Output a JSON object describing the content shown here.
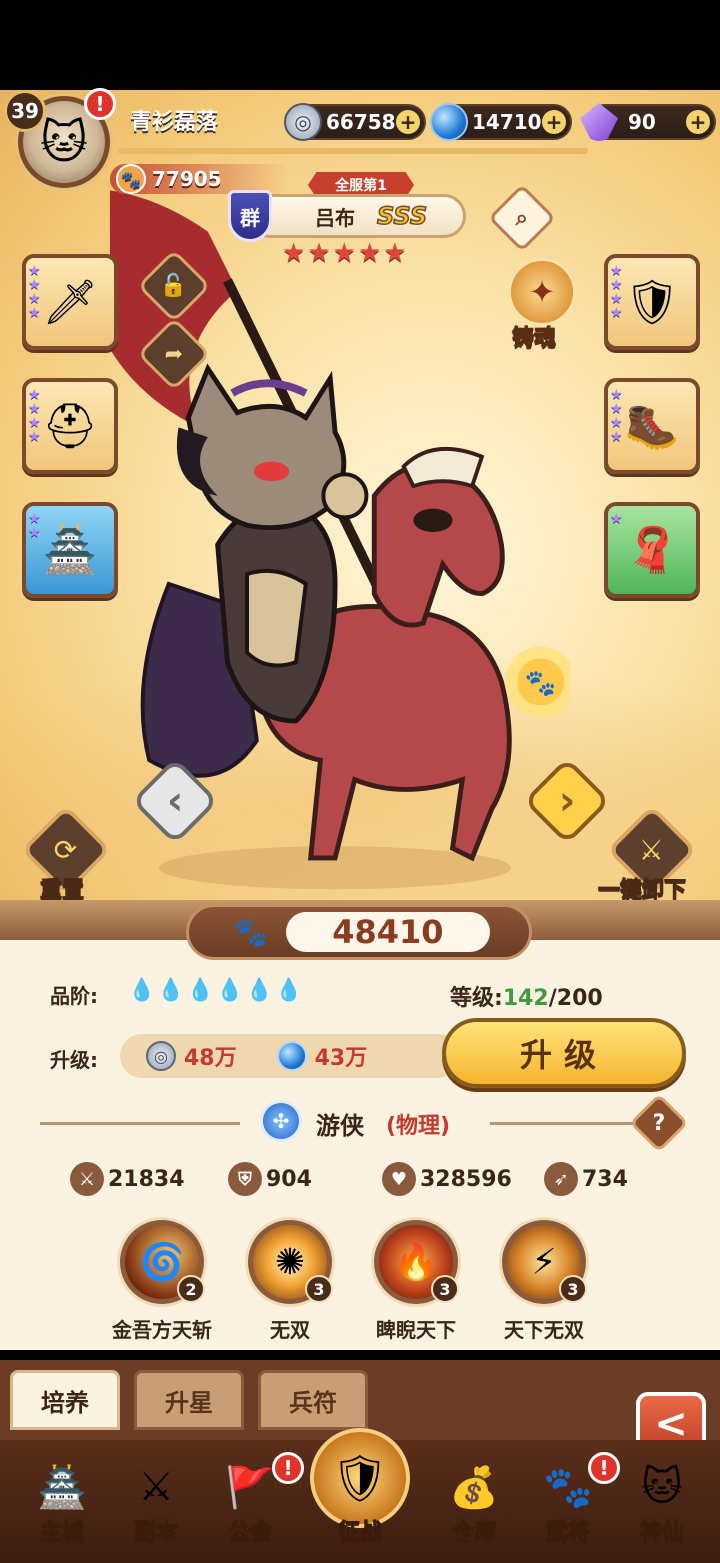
{
  "player": {
    "level": "39",
    "name": "青衫磊落",
    "power": "77905",
    "alert": "!"
  },
  "resources": [
    {
      "icon": "silver-coin-icon",
      "value": "66758"
    },
    {
      "icon": "blue-orb-icon",
      "value": "14710"
    },
    {
      "icon": "purple-crystal-icon",
      "value": "90"
    }
  ],
  "hero": {
    "rank_tag": "全服第1",
    "faction": "群",
    "name": "吕布",
    "grade": "SSS",
    "stars": 5,
    "combat_power": "48410",
    "quality_label": "品阶:",
    "quality_count": 6,
    "level_label": "等级:",
    "level_current": "142",
    "level_max": "/200",
    "upgrade_label": "升级:",
    "cost_silver": "48万",
    "cost_orb": "43万",
    "upgrade_button": "升级",
    "class_name": "游侠",
    "class_type": "(物理)",
    "help": "?"
  },
  "forge": {
    "label": "铸魂"
  },
  "actions": {
    "reset": "重置",
    "unequip_all": "一键卸下"
  },
  "stats": [
    {
      "icon": "attack-icon",
      "value": "21834"
    },
    {
      "icon": "defense-icon",
      "value": "904"
    },
    {
      "icon": "health-icon",
      "value": "328596"
    },
    {
      "icon": "speed-icon",
      "value": "734"
    }
  ],
  "skills": [
    {
      "name": "金吾方天斩",
      "level": "2"
    },
    {
      "name": "无双",
      "level": "3"
    },
    {
      "name": "睥睨天下",
      "level": "3"
    },
    {
      "name": "天下无双",
      "level": "3"
    }
  ],
  "tabs": [
    "培养",
    "升星",
    "兵符"
  ],
  "back": "<",
  "nav": [
    {
      "label": "主城",
      "icon": "city-icon"
    },
    {
      "label": "副本",
      "icon": "dungeon-icon"
    },
    {
      "label": "公会",
      "icon": "guild-icon"
    },
    {
      "label": "征战",
      "icon": "battle-icon"
    },
    {
      "label": "仓库",
      "icon": "warehouse-icon"
    },
    {
      "label": "武将",
      "icon": "generals-icon"
    },
    {
      "label": "神仙",
      "icon": "immortal-icon"
    }
  ],
  "colors": {
    "accent": "#f5b52f",
    "panel": "#fbf2e1",
    "brown": "#6b3d27",
    "red": "#c43a2e",
    "green": "#3f9b3b"
  }
}
